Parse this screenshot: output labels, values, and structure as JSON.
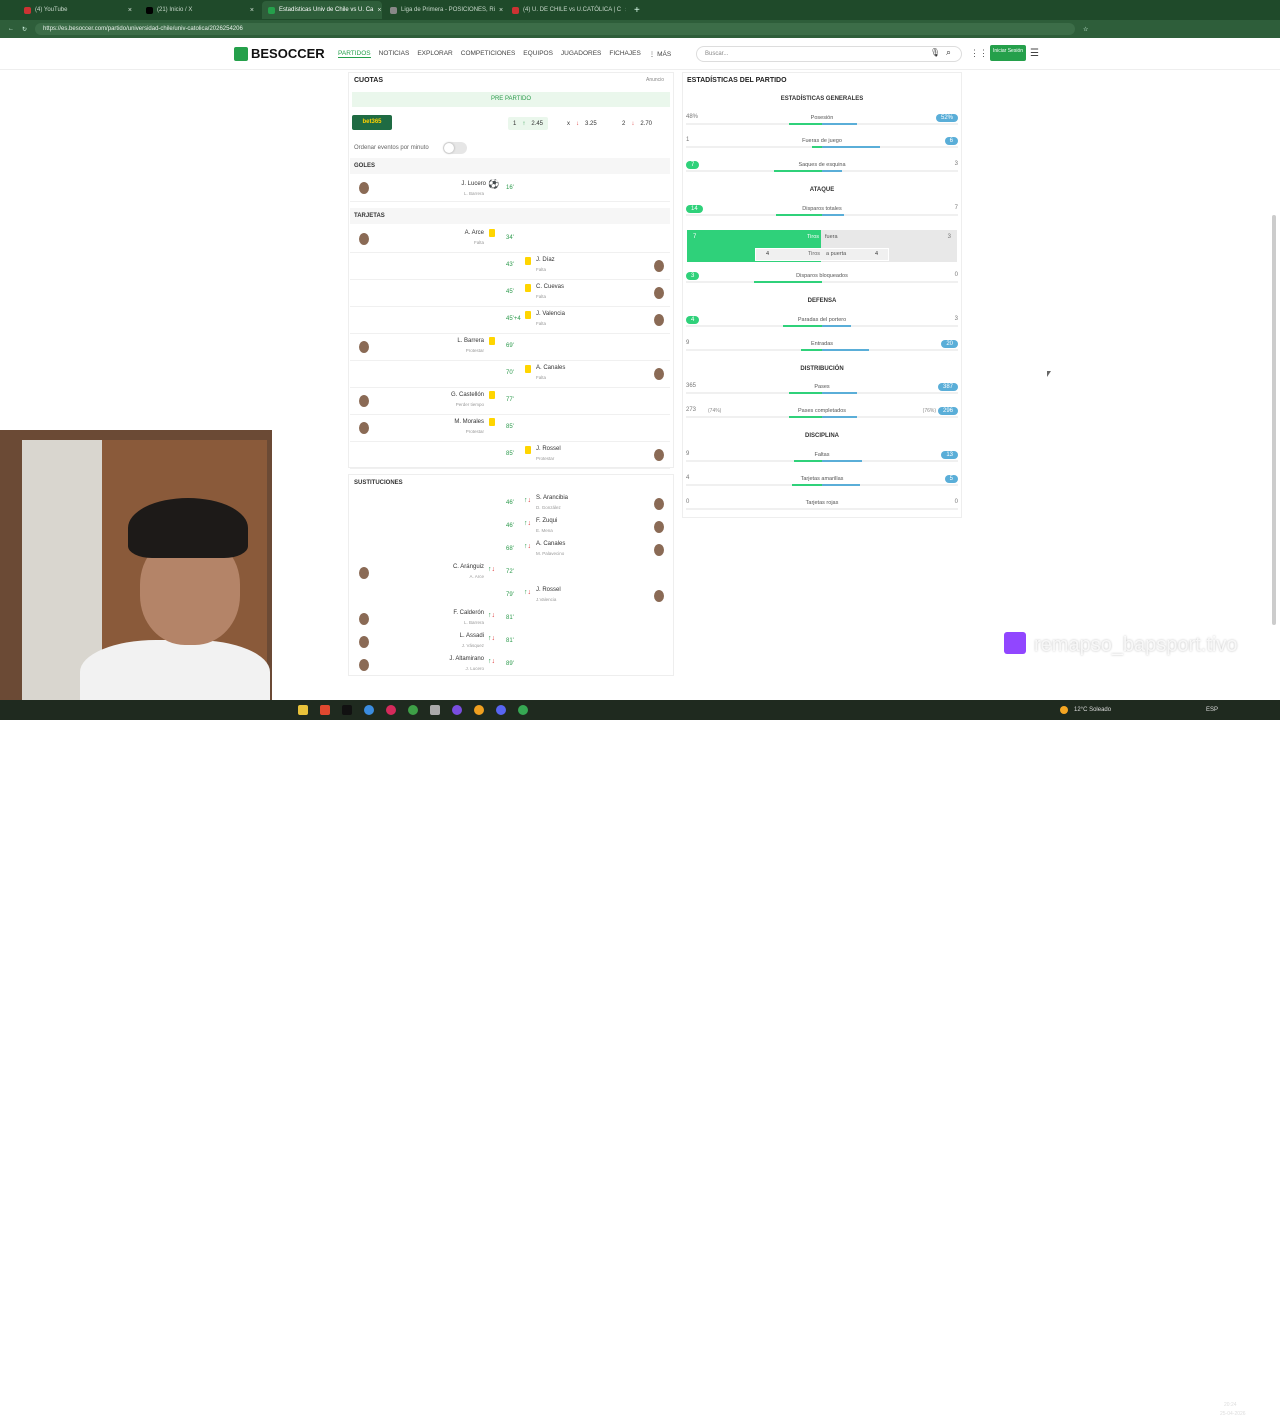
{
  "browser": {
    "tabs": [
      {
        "label": "(4) YouTube",
        "active": false
      },
      {
        "label": "(21) Inicio / X",
        "active": false
      },
      {
        "label": "Estadísticas Univ de Chile vs U. Ca",
        "active": true
      },
      {
        "label": "Liga de Primera - POSICIONES, Ri",
        "active": false
      },
      {
        "label": "(4) U. DE CHILE vs U.CATÓLICA | C",
        "active": false
      }
    ],
    "url": "https://es.besoccer.com/partido/universidad-chile/univ-catolica/2026254206"
  },
  "site": {
    "logo": "BESOCCER",
    "menu": [
      "PARTIDOS",
      "NOTICIAS",
      "EXPLORAR",
      "COMPETICIONES",
      "EQUIPOS",
      "JUGADORES",
      "FICHAJES",
      "⋮ MÁS"
    ],
    "search_placeholder": "Buscar...",
    "login": "Iniciar Sesión"
  },
  "odds": {
    "title": "CUOTAS",
    "ad": "Anuncio",
    "pre": "PRE PARTIDO",
    "bookmaker": "bet365",
    "items": [
      {
        "k": "1",
        "v": "2.45"
      },
      {
        "k": "x",
        "v": "3.25"
      },
      {
        "k": "2",
        "v": "2.70"
      }
    ],
    "sort_label": "Ordenar eventos por minuto"
  },
  "goals": {
    "title": "GOLES",
    "items": [
      {
        "name": "J. Lucero",
        "sub": "L. Barrera",
        "min": "16'"
      }
    ]
  },
  "cards": {
    "title": "TARJETAS",
    "items": [
      {
        "side": "l",
        "name": "A. Arce",
        "sub": "Falta",
        "min": "34'"
      },
      {
        "side": "r",
        "name": "J. Díaz",
        "sub": "Falta",
        "min": "43'"
      },
      {
        "side": "r",
        "name": "C. Cuevas",
        "sub": "Falta",
        "min": "45'"
      },
      {
        "side": "r",
        "name": "J. Valencia",
        "sub": "Falta",
        "min": "45'+4"
      },
      {
        "side": "l",
        "name": "L. Barrera",
        "sub": "Protestar",
        "min": "69'"
      },
      {
        "side": "r",
        "name": "A. Canales",
        "sub": "Falta",
        "min": "70'"
      },
      {
        "side": "l",
        "name": "G. Castellón",
        "sub": "Perder tiempo",
        "min": "77'"
      },
      {
        "side": "l",
        "name": "M. Morales",
        "sub": "Protestar",
        "min": "85'"
      },
      {
        "side": "r",
        "name": "J. Rossel",
        "sub": "Protestar",
        "min": "85'"
      }
    ]
  },
  "subs": {
    "title": "SUSTITUCIONES",
    "items": [
      {
        "side": "r",
        "name": "S. Arancibia",
        "sub": "D. González",
        "min": "46'"
      },
      {
        "side": "r",
        "name": "F. Zuqui",
        "sub": "E. Mena",
        "min": "46'"
      },
      {
        "side": "r",
        "name": "A. Canales",
        "sub": "M. Palavecino",
        "min": "68'"
      },
      {
        "side": "l",
        "name": "C. Aránguiz",
        "sub": "A. Arce",
        "min": "72'"
      },
      {
        "side": "r",
        "name": "J. Rossel",
        "sub": "J.Valencia",
        "min": "79'"
      },
      {
        "side": "l",
        "name": "F. Calderón",
        "sub": "L. Barrera",
        "min": "81'"
      },
      {
        "side": "l",
        "name": "L. Assadi",
        "sub": "J. Vásquez",
        "min": "81'"
      },
      {
        "side": "l",
        "name": "J. Altamirano",
        "sub": "J. Lucero",
        "min": "89'"
      }
    ]
  },
  "stats": {
    "title": "ESTADÍSTICAS DEL PARTIDO",
    "sections": {
      "general": "ESTADÍSTICAS GENERALES",
      "attack": "ATAQUE",
      "defense": "DEFENSA",
      "distribution": "DISTRIBUCIÓN",
      "discipline": "DISCIPLINA"
    },
    "rows": [
      {
        "label": "Posesión",
        "l": "48%",
        "r": "52%",
        "lp": 0.48,
        "rp": 0.52,
        "hl": "r"
      },
      {
        "label": "Fueras de juego",
        "l": "1",
        "r": "6",
        "lp": 0.14,
        "rp": 0.86,
        "hl": "r"
      },
      {
        "label": "Saques de esquina",
        "l": "7",
        "r": "3",
        "lp": 0.7,
        "rp": 0.3,
        "hl": "l"
      },
      {
        "label": "Disparos totales",
        "l": "14",
        "r": "7",
        "lp": 0.67,
        "rp": 0.33,
        "hl": "l"
      },
      {
        "label": "Disparos bloqueados",
        "l": "3",
        "r": "0",
        "lp": 1,
        "rp": 0,
        "hl": "l"
      },
      {
        "label": "Paradas del portero",
        "l": "4",
        "r": "3",
        "lp": 0.57,
        "rp": 0.43,
        "hl": "l"
      },
      {
        "label": "Entradas",
        "l": "9",
        "r": "20",
        "lp": 0.31,
        "rp": 0.69,
        "hl": "r"
      },
      {
        "label": "Pases",
        "l": "365",
        "r": "387",
        "lp": 0.49,
        "rp": 0.51,
        "hl": "r"
      },
      {
        "label": "Pases completados",
        "l": "273",
        "r": "296",
        "lp": 0.48,
        "rp": 0.52,
        "hl": "r",
        "lpct": "(74%)",
        "rpct": "(76%)"
      },
      {
        "label": "Faltas",
        "l": "9",
        "r": "13",
        "lp": 0.41,
        "rp": 0.59,
        "hl": "r"
      },
      {
        "label": "Tarjetas amarillas",
        "l": "4",
        "r": "5",
        "lp": 0.44,
        "rp": 0.56,
        "hl": "r"
      },
      {
        "label": "Tarjetas rojas",
        "l": "0",
        "r": "0",
        "lp": 0,
        "rp": 0,
        "hl": ""
      }
    ],
    "shots": {
      "l_total": "7",
      "r_total": "3",
      "label": "Tiros",
      "fuera": "fuera",
      "apuerta_l": "4",
      "apuerta_r": "4",
      "apuerta": "a puerta"
    }
  },
  "stream": {
    "twitch_name": "remapso_bapsport.tivo"
  },
  "taskbar": {
    "weather": "12°C Soleado",
    "lang": "ESP",
    "time": "20:24",
    "date": "25-04-2026"
  }
}
